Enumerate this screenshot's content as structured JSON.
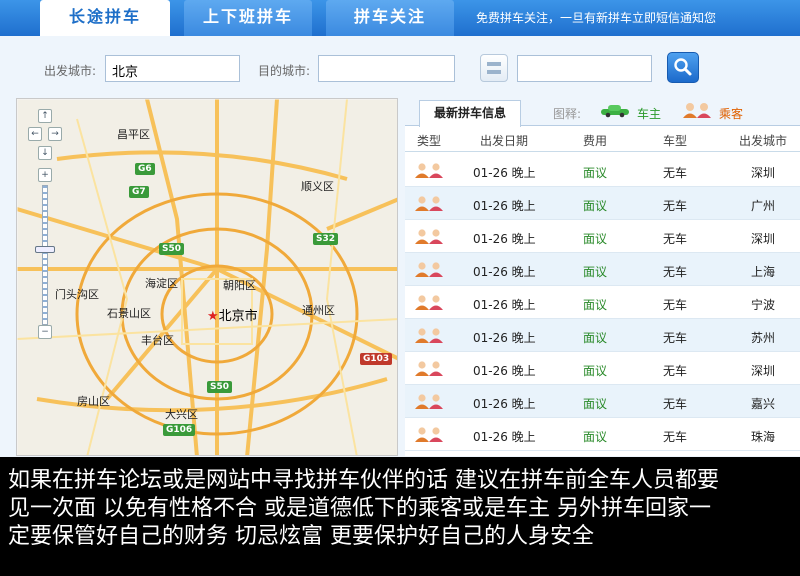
{
  "tabs": [
    {
      "label": "长途拼车",
      "active": true
    },
    {
      "label": "上下班拼车",
      "active": false
    },
    {
      "label": "拼车关注",
      "active": false
    }
  ],
  "notice": "免费拼车关注，一旦有新拼车立即短信通知您",
  "search": {
    "from_label": "出发城市:",
    "from_value": "北京",
    "to_label": "目的城市:",
    "to_value": "",
    "date_value": ""
  },
  "map": {
    "places": [
      "昌平区",
      "顺义区",
      "门头沟区",
      "海淀区",
      "朝阳区",
      "北京市",
      "石景山区",
      "通州区",
      "丰台区",
      "房山区",
      "大兴区"
    ],
    "roads": [
      "G6",
      "G7",
      "S32",
      "S50",
      "G103",
      "S50",
      "G106"
    ]
  },
  "list": {
    "tab_label": "最新拼车信息",
    "legend_label": "图释:",
    "legend_driver": "车主",
    "legend_passenger": "乘客",
    "headers": [
      "类型",
      "出发日期",
      "费用",
      "车型",
      "出发城市"
    ],
    "rows": [
      {
        "date": "01-26 晚上",
        "price": "面议",
        "car": "无车",
        "city": "深圳"
      },
      {
        "date": "01-26 晚上",
        "price": "面议",
        "car": "无车",
        "city": "广州"
      },
      {
        "date": "01-26 晚上",
        "price": "面议",
        "car": "无车",
        "city": "深圳"
      },
      {
        "date": "01-26 晚上",
        "price": "面议",
        "car": "无车",
        "city": "上海"
      },
      {
        "date": "01-26 晚上",
        "price": "面议",
        "car": "无车",
        "city": "宁波"
      },
      {
        "date": "01-26 晚上",
        "price": "面议",
        "car": "无车",
        "city": "苏州"
      },
      {
        "date": "01-26 晚上",
        "price": "面议",
        "car": "无车",
        "city": "深圳"
      },
      {
        "date": "01-26 晚上",
        "price": "面议",
        "car": "无车",
        "city": "嘉兴"
      },
      {
        "date": "01-26 晚上",
        "price": "面议",
        "car": "无车",
        "city": "珠海"
      }
    ]
  },
  "caption": {
    "line1": "如果在拼车论坛或是网站中寻找拼车伙伴的话 建议在拼车前全车人员都要",
    "line2": "见一次面 以免有性格不合 或是道德低下的乘客或是车主 另外拼车回家一",
    "line3": "定要保管好自己的财务 切忌炫富 更要保护好自己的人身安全"
  }
}
